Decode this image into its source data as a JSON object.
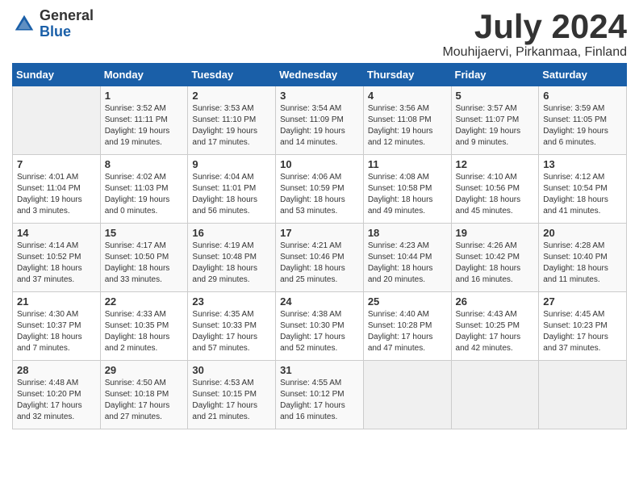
{
  "logo": {
    "general": "General",
    "blue": "Blue"
  },
  "title": {
    "month_year": "July 2024",
    "location": "Mouhijaervi, Pirkanmaa, Finland"
  },
  "weekdays": [
    "Sunday",
    "Monday",
    "Tuesday",
    "Wednesday",
    "Thursday",
    "Friday",
    "Saturday"
  ],
  "weeks": [
    [
      {
        "day": "",
        "info": ""
      },
      {
        "day": "1",
        "info": "Sunrise: 3:52 AM\nSunset: 11:11 PM\nDaylight: 19 hours\nand 19 minutes."
      },
      {
        "day": "2",
        "info": "Sunrise: 3:53 AM\nSunset: 11:10 PM\nDaylight: 19 hours\nand 17 minutes."
      },
      {
        "day": "3",
        "info": "Sunrise: 3:54 AM\nSunset: 11:09 PM\nDaylight: 19 hours\nand 14 minutes."
      },
      {
        "day": "4",
        "info": "Sunrise: 3:56 AM\nSunset: 11:08 PM\nDaylight: 19 hours\nand 12 minutes."
      },
      {
        "day": "5",
        "info": "Sunrise: 3:57 AM\nSunset: 11:07 PM\nDaylight: 19 hours\nand 9 minutes."
      },
      {
        "day": "6",
        "info": "Sunrise: 3:59 AM\nSunset: 11:05 PM\nDaylight: 19 hours\nand 6 minutes."
      }
    ],
    [
      {
        "day": "7",
        "info": "Sunrise: 4:01 AM\nSunset: 11:04 PM\nDaylight: 19 hours\nand 3 minutes."
      },
      {
        "day": "8",
        "info": "Sunrise: 4:02 AM\nSunset: 11:03 PM\nDaylight: 19 hours\nand 0 minutes."
      },
      {
        "day": "9",
        "info": "Sunrise: 4:04 AM\nSunset: 11:01 PM\nDaylight: 18 hours\nand 56 minutes."
      },
      {
        "day": "10",
        "info": "Sunrise: 4:06 AM\nSunset: 10:59 PM\nDaylight: 18 hours\nand 53 minutes."
      },
      {
        "day": "11",
        "info": "Sunrise: 4:08 AM\nSunset: 10:58 PM\nDaylight: 18 hours\nand 49 minutes."
      },
      {
        "day": "12",
        "info": "Sunrise: 4:10 AM\nSunset: 10:56 PM\nDaylight: 18 hours\nand 45 minutes."
      },
      {
        "day": "13",
        "info": "Sunrise: 4:12 AM\nSunset: 10:54 PM\nDaylight: 18 hours\nand 41 minutes."
      }
    ],
    [
      {
        "day": "14",
        "info": "Sunrise: 4:14 AM\nSunset: 10:52 PM\nDaylight: 18 hours\nand 37 minutes."
      },
      {
        "day": "15",
        "info": "Sunrise: 4:17 AM\nSunset: 10:50 PM\nDaylight: 18 hours\nand 33 minutes."
      },
      {
        "day": "16",
        "info": "Sunrise: 4:19 AM\nSunset: 10:48 PM\nDaylight: 18 hours\nand 29 minutes."
      },
      {
        "day": "17",
        "info": "Sunrise: 4:21 AM\nSunset: 10:46 PM\nDaylight: 18 hours\nand 25 minutes."
      },
      {
        "day": "18",
        "info": "Sunrise: 4:23 AM\nSunset: 10:44 PM\nDaylight: 18 hours\nand 20 minutes."
      },
      {
        "day": "19",
        "info": "Sunrise: 4:26 AM\nSunset: 10:42 PM\nDaylight: 18 hours\nand 16 minutes."
      },
      {
        "day": "20",
        "info": "Sunrise: 4:28 AM\nSunset: 10:40 PM\nDaylight: 18 hours\nand 11 minutes."
      }
    ],
    [
      {
        "day": "21",
        "info": "Sunrise: 4:30 AM\nSunset: 10:37 PM\nDaylight: 18 hours\nand 7 minutes."
      },
      {
        "day": "22",
        "info": "Sunrise: 4:33 AM\nSunset: 10:35 PM\nDaylight: 18 hours\nand 2 minutes."
      },
      {
        "day": "23",
        "info": "Sunrise: 4:35 AM\nSunset: 10:33 PM\nDaylight: 17 hours\nand 57 minutes."
      },
      {
        "day": "24",
        "info": "Sunrise: 4:38 AM\nSunset: 10:30 PM\nDaylight: 17 hours\nand 52 minutes."
      },
      {
        "day": "25",
        "info": "Sunrise: 4:40 AM\nSunset: 10:28 PM\nDaylight: 17 hours\nand 47 minutes."
      },
      {
        "day": "26",
        "info": "Sunrise: 4:43 AM\nSunset: 10:25 PM\nDaylight: 17 hours\nand 42 minutes."
      },
      {
        "day": "27",
        "info": "Sunrise: 4:45 AM\nSunset: 10:23 PM\nDaylight: 17 hours\nand 37 minutes."
      }
    ],
    [
      {
        "day": "28",
        "info": "Sunrise: 4:48 AM\nSunset: 10:20 PM\nDaylight: 17 hours\nand 32 minutes."
      },
      {
        "day": "29",
        "info": "Sunrise: 4:50 AM\nSunset: 10:18 PM\nDaylight: 17 hours\nand 27 minutes."
      },
      {
        "day": "30",
        "info": "Sunrise: 4:53 AM\nSunset: 10:15 PM\nDaylight: 17 hours\nand 21 minutes."
      },
      {
        "day": "31",
        "info": "Sunrise: 4:55 AM\nSunset: 10:12 PM\nDaylight: 17 hours\nand 16 minutes."
      },
      {
        "day": "",
        "info": ""
      },
      {
        "day": "",
        "info": ""
      },
      {
        "day": "",
        "info": ""
      }
    ]
  ]
}
